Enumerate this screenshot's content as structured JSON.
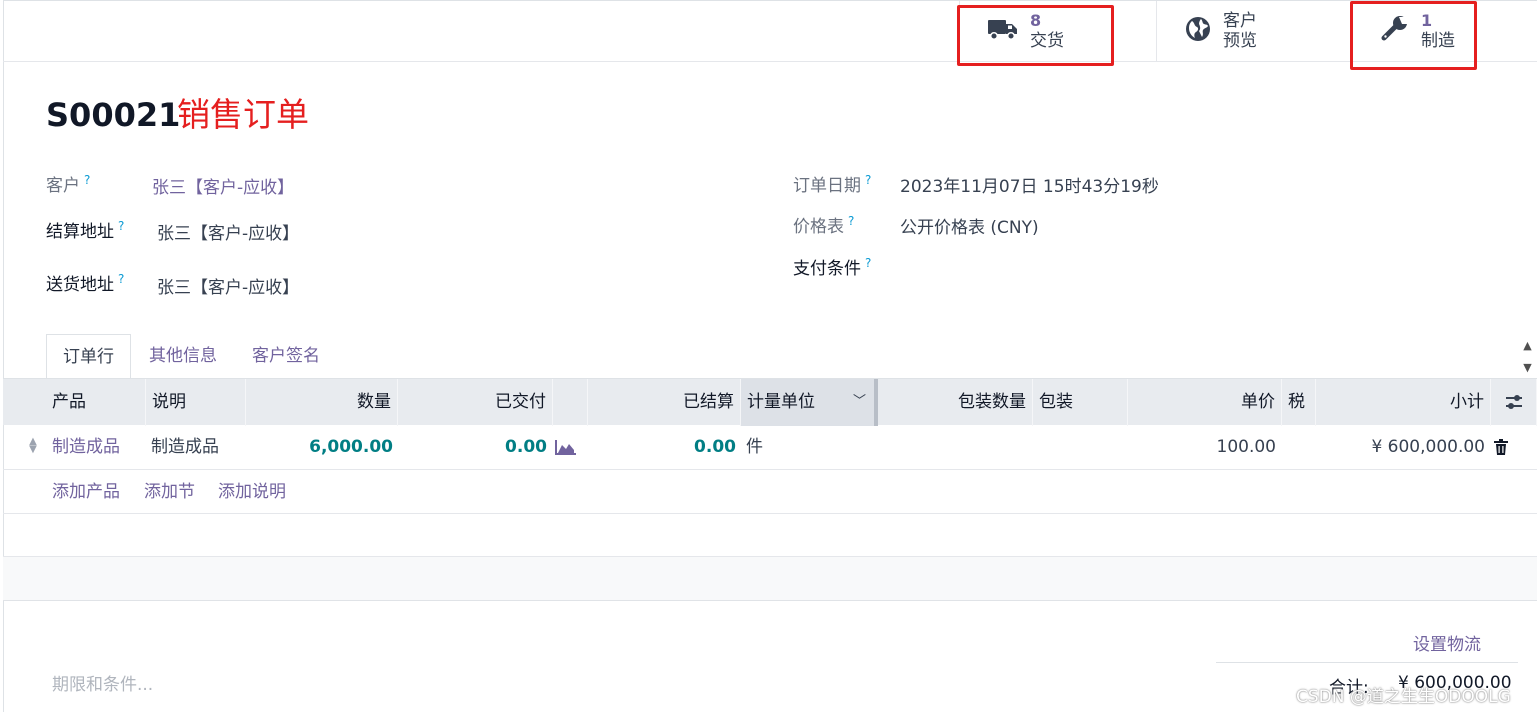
{
  "smart_buttons": {
    "delivery": {
      "count": "8",
      "label": "交货"
    },
    "customer_preview": {
      "line1": "客户",
      "line2": "预览"
    },
    "manufacturing": {
      "count": "1",
      "label": "制造"
    }
  },
  "header": {
    "title": "S00021",
    "annotation": "销售订单"
  },
  "fields": {
    "customer": {
      "label": "客户",
      "help": "?",
      "value": "张三【客户-应收】"
    },
    "invoice_address": {
      "label": "结算地址",
      "help": "?",
      "value": "张三【客户-应收】"
    },
    "delivery_address": {
      "label": "送货地址",
      "help": "?",
      "value": "张三【客户-应收】"
    },
    "order_date": {
      "label": "订单日期",
      "help": "?",
      "value": "2023年11月07日 15时43分19秒"
    },
    "pricelist": {
      "label": "价格表",
      "help": "?",
      "value": "公开价格表 (CNY)"
    },
    "payment_terms": {
      "label": "支付条件",
      "help": "?",
      "value": ""
    }
  },
  "tabs": [
    "订单行",
    "其他信息",
    "客户签名"
  ],
  "table": {
    "columns": {
      "product": "产品",
      "description": "说明",
      "quantity": "数量",
      "delivered": "已交付",
      "invoiced": "已结算",
      "uom": "计量单位",
      "packaging_qty": "包装数量",
      "packaging": "包装",
      "unit_price": "单价",
      "taxes": "税",
      "subtotal": "小计"
    },
    "rows": [
      {
        "product": "制造成品",
        "description": "制造成品",
        "quantity": "6,000.00",
        "delivered": "0.00",
        "invoiced": "0.00",
        "uom": "件",
        "unit_price": "100.00",
        "subtotal": "¥ 600,000.00"
      }
    ],
    "add_links": {
      "product": "添加产品",
      "section": "添加节",
      "note": "添加说明"
    }
  },
  "footer": {
    "terms_placeholder": "期限和条件...",
    "set_logistics": "设置物流",
    "total_label": "合计:",
    "total_value": "¥ 600,000.00"
  },
  "watermark": "CSDN @道之生生ODOOLG",
  "colors": {
    "accent": "#71639e",
    "numbers": "#017e84",
    "annotation": "#e51f1f"
  }
}
